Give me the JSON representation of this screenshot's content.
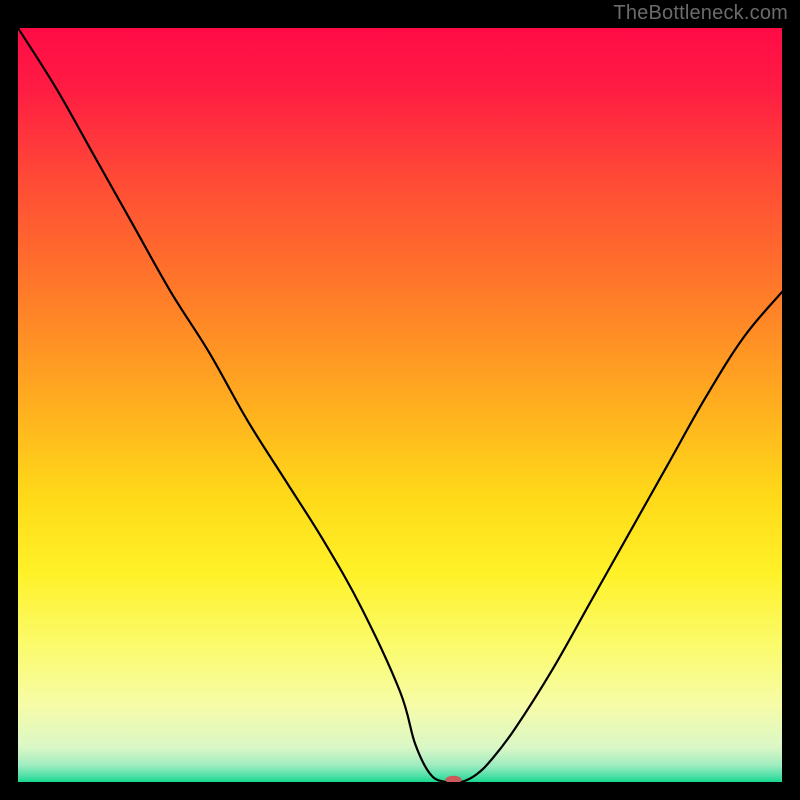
{
  "attribution": "TheBottleneck.com",
  "chart_data": {
    "type": "line",
    "title": "",
    "xlabel": "",
    "ylabel": "",
    "xlim": [
      0,
      100
    ],
    "ylim": [
      0,
      100
    ],
    "grid": false,
    "series": [
      {
        "name": "bottleneck-curve",
        "color": "#000000",
        "x": [
          0,
          5,
          10,
          15,
          20,
          25,
          30,
          35,
          40,
          45,
          50,
          52,
          54,
          56,
          58,
          60,
          62,
          65,
          70,
          75,
          80,
          85,
          90,
          95,
          100
        ],
        "y": [
          100,
          92,
          83,
          74,
          65,
          57,
          48,
          40,
          32,
          23,
          12,
          5,
          1,
          0,
          0,
          1,
          3,
          7,
          15,
          24,
          33,
          42,
          51,
          59,
          65
        ]
      }
    ],
    "marker": {
      "x": 57,
      "y": 0.3,
      "color": "#cd5a5a",
      "rx": 8,
      "ry": 4
    },
    "background_gradient": {
      "stops": [
        {
          "offset": 0.0,
          "color": "#ff0b46"
        },
        {
          "offset": 0.08,
          "color": "#ff1c43"
        },
        {
          "offset": 0.2,
          "color": "#ff4a36"
        },
        {
          "offset": 0.35,
          "color": "#ff7a29"
        },
        {
          "offset": 0.5,
          "color": "#ffae1f"
        },
        {
          "offset": 0.62,
          "color": "#ffd919"
        },
        {
          "offset": 0.72,
          "color": "#fff127"
        },
        {
          "offset": 0.82,
          "color": "#fbfb6d"
        },
        {
          "offset": 0.9,
          "color": "#f6fca9"
        },
        {
          "offset": 0.955,
          "color": "#d9f7c6"
        },
        {
          "offset": 0.978,
          "color": "#9eecc0"
        },
        {
          "offset": 0.992,
          "color": "#4fe0a8"
        },
        {
          "offset": 1.0,
          "color": "#16d88f"
        }
      ]
    }
  }
}
